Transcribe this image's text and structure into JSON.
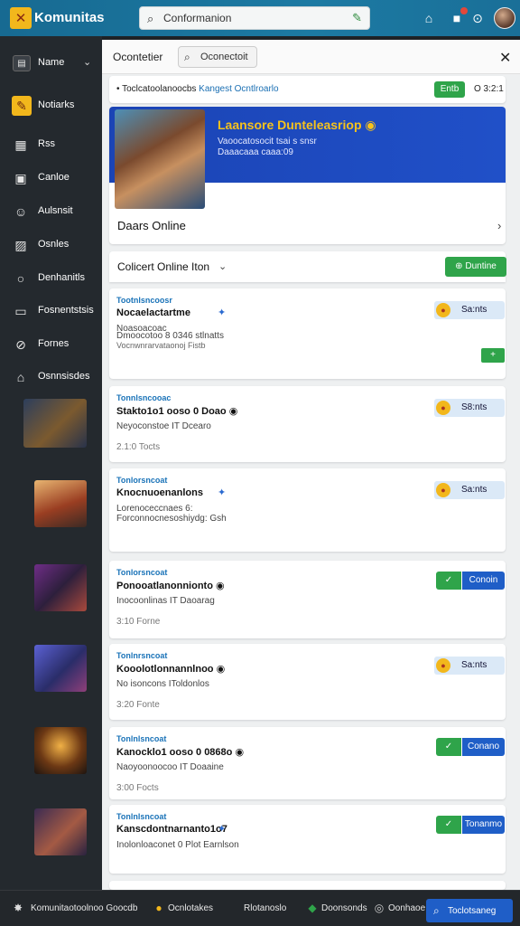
{
  "topbar": {
    "brand": "Komunitas",
    "search_value": "Conformanion",
    "icons": [
      "home-icon",
      "notification-icon",
      "settings-icon"
    ]
  },
  "sidebar": {
    "name_label": "Name",
    "items": [
      {
        "label": "Notiarks",
        "icon": "notes-icon",
        "active": true
      },
      {
        "label": "Rss",
        "icon": "chart-icon"
      },
      {
        "label": "Canloe",
        "icon": "grid-icon"
      },
      {
        "label": "Aulsnsit",
        "icon": "user-icon"
      },
      {
        "label": "Osnles",
        "icon": "image-icon"
      },
      {
        "label": "Denhanitls",
        "icon": "search-icon"
      },
      {
        "label": "Fosnentstsis",
        "icon": "folder-icon"
      },
      {
        "label": "Fornes",
        "icon": "compass-icon"
      },
      {
        "label": "Osnnsisdes",
        "icon": "store-icon"
      }
    ]
  },
  "panel": {
    "title": "Ocontetier",
    "tab_label": "Oconectoit",
    "notice": {
      "text": "Toclcatoolanoocbs",
      "highlight": "Kangest Ocntlroarlo",
      "button": "Entb",
      "time": "O 3:2:1"
    },
    "feature": {
      "title": "Laansore Dunteleasriop",
      "subtitle1": "Vaoocatosocit tsai s snsr",
      "subtitle2": "Daaacaaa caaa:09",
      "name": "Daars Online"
    },
    "filter": {
      "dropdown": "Colicert Online Iton",
      "button": "Duntine"
    }
  },
  "posts": [
    {
      "tag": "Tootnlsncoosr",
      "title": "Nocaelactartme",
      "meta1": "Noasoacoac",
      "meta2": "Dmoocotoo 8 0346 stlnatts",
      "meta3": "Vocnwnrarvataonoj Fistb",
      "action": "price",
      "price": "Sa:nts"
    },
    {
      "tag": "Tonnlsncooac",
      "title": "Stakto1o1 ooso 0 Doao",
      "meta1": "Neyoconstoe IT Dcearo",
      "foot": "2.1:0 Tocts",
      "action": "price",
      "price": "S8:nts"
    },
    {
      "tag": "Tonlorsncoat",
      "title": "Knocnuoenanlons",
      "meta1": "Lorenoceccnaes 6:",
      "meta2": "Forconnocnesoshiydg: Gsh",
      "action": "price",
      "price": "Sa:nts"
    },
    {
      "tag": "Tonlorsncoat",
      "title": "Ponooatlanonnionto",
      "meta1": "Inocoonlinas IT Daoarag",
      "foot": "3:10 Forne",
      "action": "join",
      "join": "Conoin"
    },
    {
      "tag": "Tonlnrsncoat",
      "title": "Kooolotlonnannlnoo",
      "meta1": "No isoncons IToldonlos",
      "foot": "3:20 Fonte",
      "action": "price",
      "price": "Sa:nts"
    },
    {
      "tag": "Tonlnlsncoat",
      "title": "Kanocklo1 ooso 0 0868o",
      "meta1": "Naoyoonoocoo IT Doaaine",
      "foot": "3:00 Focts",
      "action": "join",
      "join": "Conano"
    },
    {
      "tag": "Tonlnlsncoat",
      "title": "Kanscdontnarnanto1o7",
      "meta1": "Inolonloaconet 0 Plot Earnlson",
      "action": "join",
      "join": "Tonanmo"
    }
  ],
  "bottombar": {
    "items": [
      {
        "label": "Komunitaotoolnoo Goocdb",
        "icon": "community-icon"
      },
      {
        "label": "Ocnlotakes",
        "icon": "coin-icon"
      },
      {
        "label": "Rlotanoslo",
        "icon": "none"
      },
      {
        "label": "Doonsonds",
        "icon": "shield-icon"
      },
      {
        "label": "Oonhaoe",
        "icon": "circle-icon"
      }
    ],
    "active_label": "Toclotsaneg"
  }
}
